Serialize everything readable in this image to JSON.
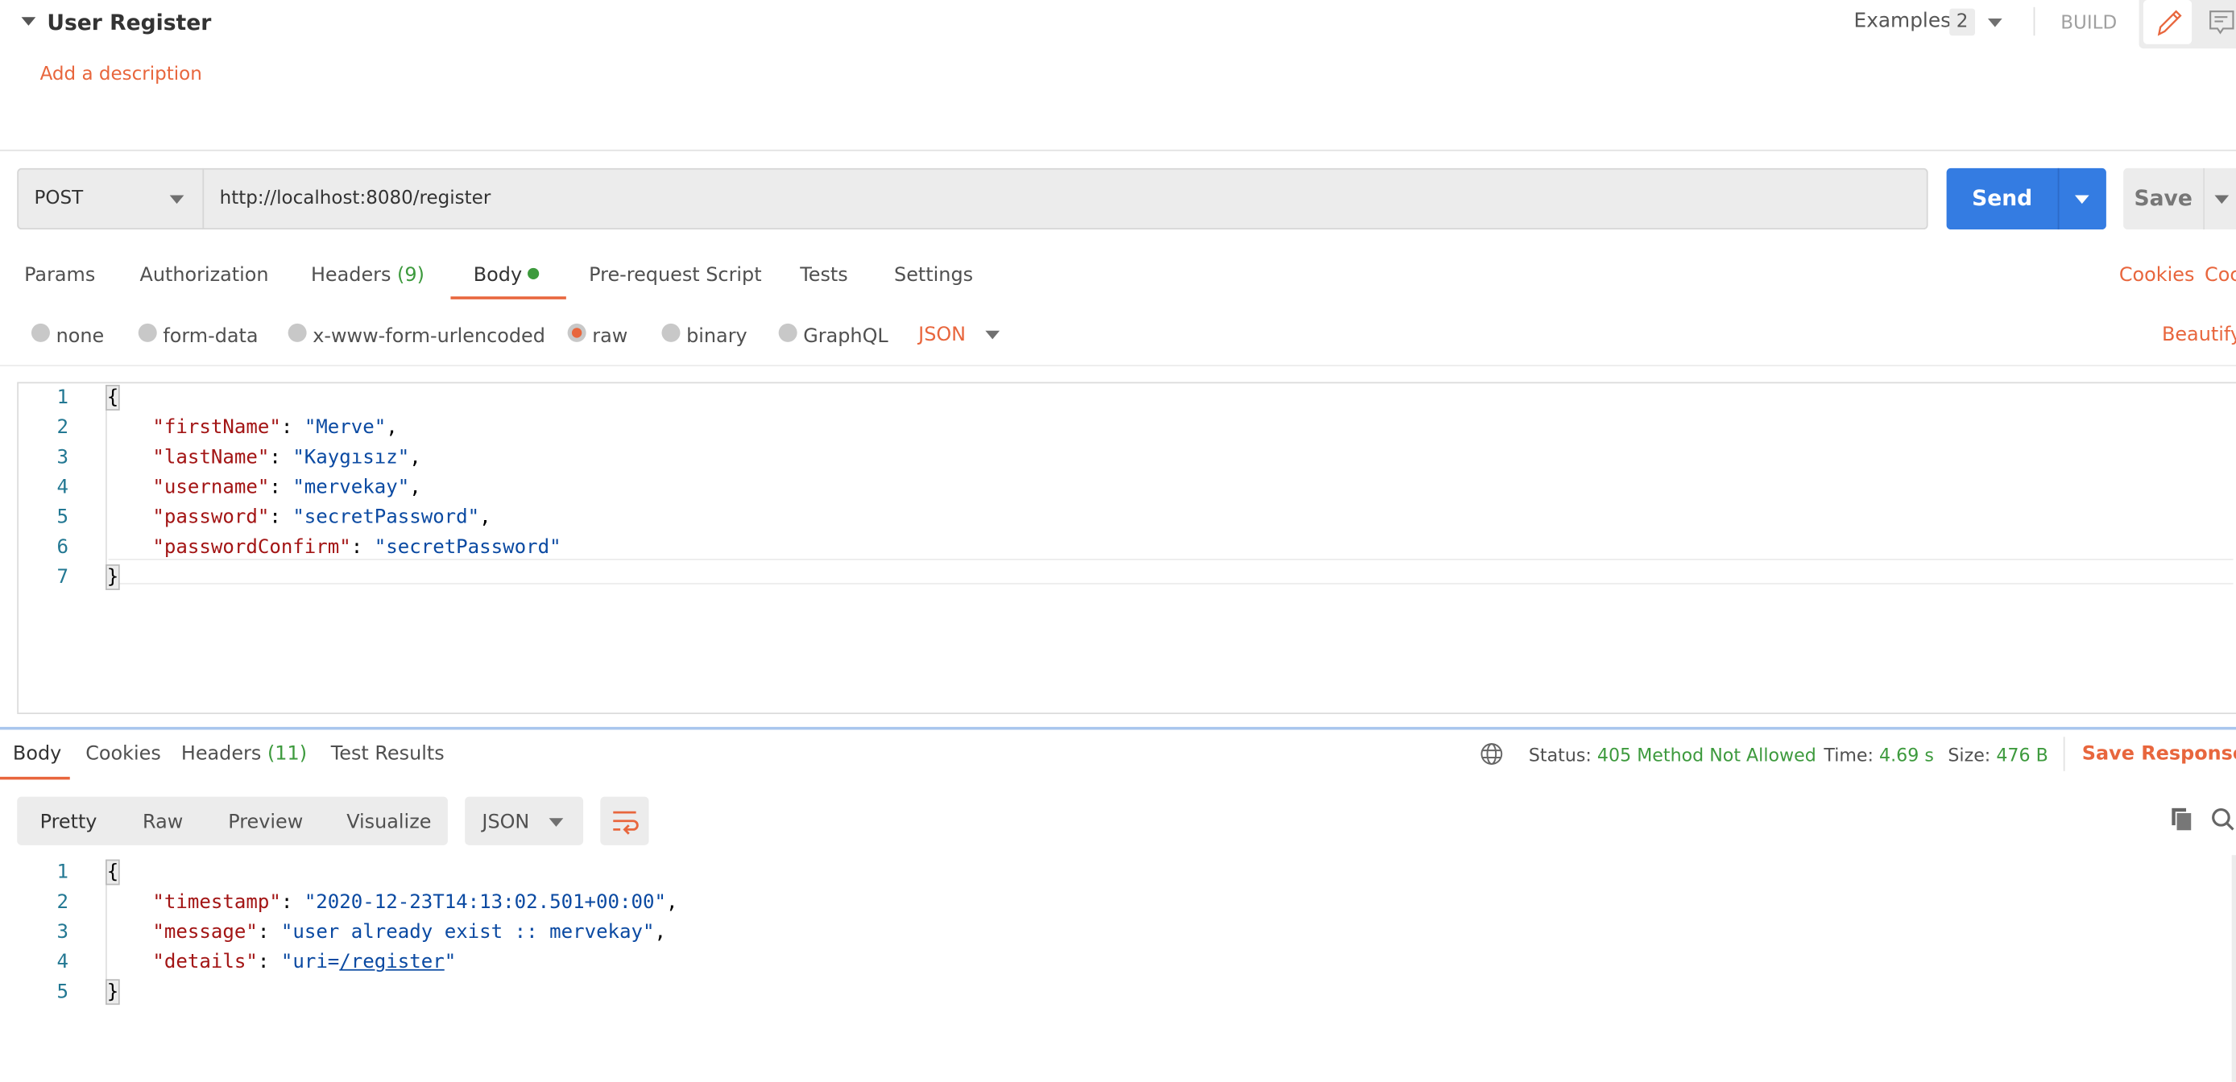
{
  "request": {
    "title": "User Register",
    "description_link": "Add a description",
    "examples_label": "Examples",
    "examples_count": "2",
    "build_label": "BUILD",
    "method": "POST",
    "url": "http://localhost:8080/register",
    "send_label": "Send",
    "save_label": "Save",
    "tabs": [
      {
        "label": "Params"
      },
      {
        "label": "Authorization"
      },
      {
        "label": "Headers",
        "count": "(9)"
      },
      {
        "label": "Body",
        "active": true
      },
      {
        "label": "Pre-request Script"
      },
      {
        "label": "Tests"
      },
      {
        "label": "Settings"
      }
    ],
    "cookies_label": "Cookies",
    "code_label": "Coc",
    "body_modes": [
      "none",
      "form-data",
      "x-www-form-urlencoded",
      "raw",
      "binary",
      "GraphQL"
    ],
    "selected_mode": "raw",
    "format": "JSON",
    "beautify_label": "Beautify",
    "body_lines": [
      {
        "n": "1",
        "text": "{"
      },
      {
        "n": "2",
        "key": "\"firstName\"",
        "value": "\"Merve\"",
        "tail": ","
      },
      {
        "n": "3",
        "key": "\"lastName\"",
        "value": "\"Kaygısız\"",
        "tail": ","
      },
      {
        "n": "4",
        "key": "\"username\"",
        "value": "\"mervekay\"",
        "tail": ","
      },
      {
        "n": "5",
        "key": "\"password\"",
        "value": "\"secretPassword\"",
        "tail": ","
      },
      {
        "n": "6",
        "key": "\"passwordConfirm\"",
        "value": "\"secretPassword\"",
        "tail": ""
      },
      {
        "n": "7",
        "text": "}"
      }
    ]
  },
  "response": {
    "tabs": [
      {
        "label": "Body",
        "active": true
      },
      {
        "label": "Cookies"
      },
      {
        "label": "Headers",
        "count": "(11)"
      },
      {
        "label": "Test Results"
      }
    ],
    "status_label": "Status:",
    "status_value": "405 Method Not Allowed",
    "time_label": "Time:",
    "time_value": "4.69 s",
    "size_label": "Size:",
    "size_value": "476 B",
    "save_response_label": "Save Response",
    "view_modes": [
      "Pretty",
      "Raw",
      "Preview",
      "Visualize"
    ],
    "selected_view": "Pretty",
    "format": "JSON",
    "body_lines": [
      {
        "n": "1",
        "text": "{"
      },
      {
        "n": "2",
        "key": "\"timestamp\"",
        "value": "\"2020-12-23T14:13:02.501+00:00\"",
        "tail": ","
      },
      {
        "n": "3",
        "key": "\"message\"",
        "value": "\"user already exist :: mervekay\"",
        "tail": ","
      },
      {
        "n": "4",
        "key": "\"details\"",
        "value_pre": "\"uri=",
        "value_link": "/register",
        "value_post": "\"",
        "tail": ""
      },
      {
        "n": "5",
        "text": "}"
      }
    ]
  },
  "colors": {
    "accent": "#e8663d",
    "send": "#347ce2",
    "success": "#3d9a3d"
  }
}
